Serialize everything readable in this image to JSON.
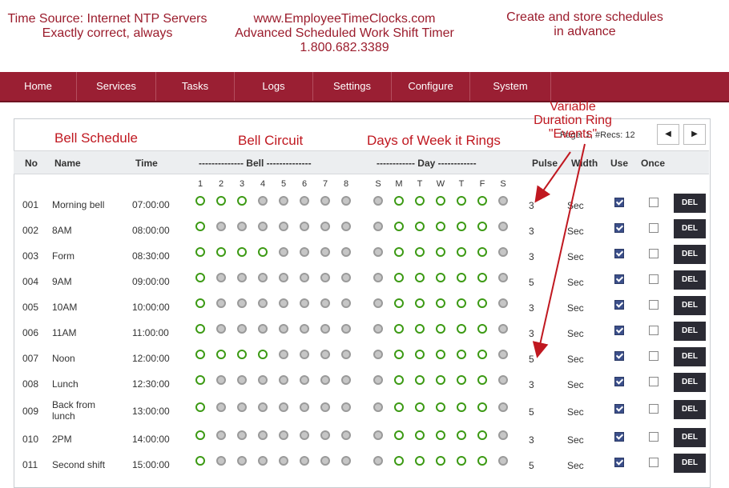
{
  "header": {
    "left": [
      "Time Source:  Internet NTP Servers",
      "Exactly correct, always"
    ],
    "center": [
      "www.EmployeeTimeClocks.com",
      "Advanced Scheduled Work Shift Timer",
      "1.800.682.3389"
    ],
    "right": [
      "Create and store schedules",
      "in advance"
    ]
  },
  "nav": [
    "Home",
    "Services",
    "Tasks",
    "Logs",
    "Settings",
    "Configure",
    "System"
  ],
  "annotations": {
    "bell_schedule": "Bell Schedule",
    "bell_circuit": "Bell Circuit",
    "days_of_week": "Days of Week it Rings",
    "variable": [
      "Variable",
      "Duration Ring",
      "\"Events\""
    ]
  },
  "pager": {
    "text": "Page: 1, #Recs: 12",
    "prev_icon": "chevron-left-icon",
    "next_icon": "chevron-right-icon"
  },
  "table": {
    "columns": {
      "no": "No",
      "name": "Name",
      "time": "Time",
      "bell": "-------------- Bell --------------",
      "day": "------------ Day ------------",
      "pulse": "Pulse",
      "width": "Width",
      "use": "Use",
      "once": "Once"
    },
    "bell_numbers": [
      "1",
      "2",
      "3",
      "4",
      "5",
      "6",
      "7",
      "8"
    ],
    "day_letters": [
      "S",
      "M",
      "T",
      "W",
      "T",
      "F",
      "S"
    ],
    "del_label": "DEL",
    "rows": [
      {
        "no": "001",
        "name": "Morning bell",
        "time": "07:00:00",
        "bells": [
          1,
          1,
          1,
          0,
          0,
          0,
          0,
          0
        ],
        "days": [
          0,
          1,
          1,
          1,
          1,
          1,
          0
        ],
        "pulse": "3",
        "width": "Sec",
        "use": true,
        "once": false
      },
      {
        "no": "002",
        "name": "8AM",
        "time": "08:00:00",
        "bells": [
          1,
          0,
          0,
          0,
          0,
          0,
          0,
          0
        ],
        "days": [
          0,
          1,
          1,
          1,
          1,
          1,
          0
        ],
        "pulse": "3",
        "width": "Sec",
        "use": true,
        "once": false
      },
      {
        "no": "003",
        "name": "Form",
        "time": "08:30:00",
        "bells": [
          1,
          1,
          1,
          1,
          0,
          0,
          0,
          0
        ],
        "days": [
          0,
          1,
          1,
          1,
          1,
          1,
          0
        ],
        "pulse": "3",
        "width": "Sec",
        "use": true,
        "once": false
      },
      {
        "no": "004",
        "name": "9AM",
        "time": "09:00:00",
        "bells": [
          1,
          0,
          0,
          0,
          0,
          0,
          0,
          0
        ],
        "days": [
          0,
          1,
          1,
          1,
          1,
          1,
          0
        ],
        "pulse": "5",
        "width": "Sec",
        "use": true,
        "once": false
      },
      {
        "no": "005",
        "name": "10AM",
        "time": "10:00:00",
        "bells": [
          1,
          0,
          0,
          0,
          0,
          0,
          0,
          0
        ],
        "days": [
          0,
          1,
          1,
          1,
          1,
          1,
          0
        ],
        "pulse": "3",
        "width": "Sec",
        "use": true,
        "once": false
      },
      {
        "no": "006",
        "name": "11AM",
        "time": "11:00:00",
        "bells": [
          1,
          0,
          0,
          0,
          0,
          0,
          0,
          0
        ],
        "days": [
          0,
          1,
          1,
          1,
          1,
          1,
          0
        ],
        "pulse": "3",
        "width": "Sec",
        "use": true,
        "once": false
      },
      {
        "no": "007",
        "name": "Noon",
        "time": "12:00:00",
        "bells": [
          1,
          1,
          1,
          1,
          0,
          0,
          0,
          0
        ],
        "days": [
          0,
          1,
          1,
          1,
          1,
          1,
          0
        ],
        "pulse": "5",
        "width": "Sec",
        "use": true,
        "once": false
      },
      {
        "no": "008",
        "name": "Lunch",
        "time": "12:30:00",
        "bells": [
          1,
          0,
          0,
          0,
          0,
          0,
          0,
          0
        ],
        "days": [
          0,
          1,
          1,
          1,
          1,
          1,
          0
        ],
        "pulse": "3",
        "width": "Sec",
        "use": true,
        "once": false
      },
      {
        "no": "009",
        "name": "Back from lunch",
        "time": "13:00:00",
        "bells": [
          1,
          0,
          0,
          0,
          0,
          0,
          0,
          0
        ],
        "days": [
          0,
          1,
          1,
          1,
          1,
          1,
          0
        ],
        "pulse": "5",
        "width": "Sec",
        "use": true,
        "once": false
      },
      {
        "no": "010",
        "name": "2PM",
        "time": "14:00:00",
        "bells": [
          1,
          0,
          0,
          0,
          0,
          0,
          0,
          0
        ],
        "days": [
          0,
          1,
          1,
          1,
          1,
          1,
          0
        ],
        "pulse": "3",
        "width": "Sec",
        "use": true,
        "once": false
      },
      {
        "no": "011",
        "name": "Second shift",
        "time": "15:00:00",
        "bells": [
          1,
          0,
          0,
          0,
          0,
          0,
          0,
          0
        ],
        "days": [
          0,
          1,
          1,
          1,
          1,
          1,
          0
        ],
        "pulse": "5",
        "width": "Sec",
        "use": true,
        "once": false
      }
    ]
  },
  "colors": {
    "brand": "#9a1f33",
    "active_ring": "#3c9a14",
    "annotation": "#c01820",
    "header_text": "#9b1c2c"
  }
}
